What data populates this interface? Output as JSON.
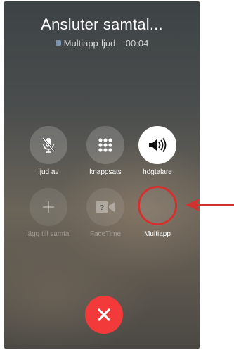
{
  "call": {
    "status": "Ansluter samtal...",
    "subtitle": "Multiapp-ljud – 00:04"
  },
  "keys": {
    "mute": "ljud av",
    "keypad": "knappsats",
    "speaker": "högtalare",
    "add_call": "lägg till samtal",
    "facetime": "FaceTime",
    "multiapp": "Multiapp"
  },
  "colors": {
    "end_call": "#f23a3a",
    "highlight": "#d2312f"
  },
  "icons": {
    "mute": "mic-off-icon",
    "keypad": "keypad-grid-icon",
    "speaker": "speaker-icon",
    "add_call": "plus-icon",
    "facetime": "facetime-camera-icon",
    "end_call": "close-icon"
  }
}
